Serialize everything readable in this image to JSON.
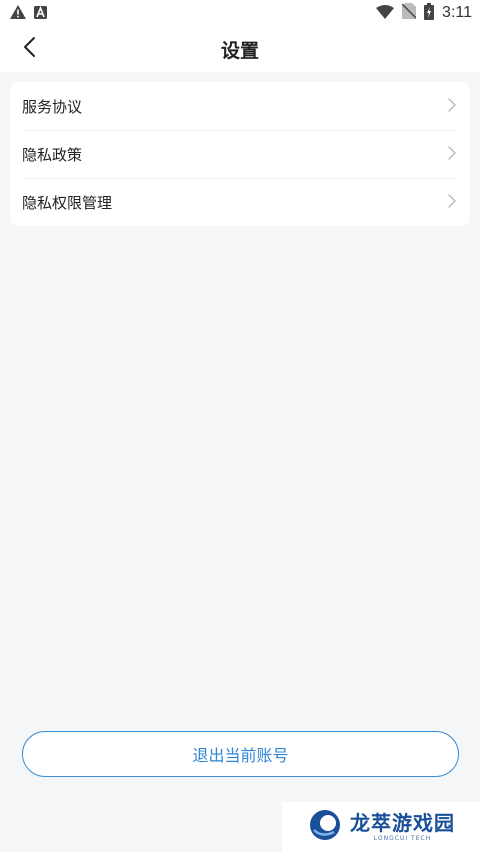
{
  "status_bar": {
    "time": "3:11",
    "icons": [
      "warning-icon",
      "font-a-icon",
      "wifi-icon",
      "no-sim-icon",
      "battery-charging-icon"
    ]
  },
  "nav": {
    "title": "设置",
    "back_icon": "chevron-left-icon"
  },
  "menu": {
    "items": [
      {
        "label": "服务协议",
        "icon": "chevron-right-icon"
      },
      {
        "label": "隐私政策",
        "icon": "chevron-right-icon"
      },
      {
        "label": "隐私权限管理",
        "icon": "chevron-right-icon"
      }
    ]
  },
  "logout": {
    "label": "退出当前账号"
  },
  "watermark": {
    "name_cn": "龙萃游戏园",
    "name_en": "LONGCUI TECH"
  },
  "colors": {
    "background": "#f5f6f8",
    "card": "#ffffff",
    "accent": "#2f86d4"
  }
}
